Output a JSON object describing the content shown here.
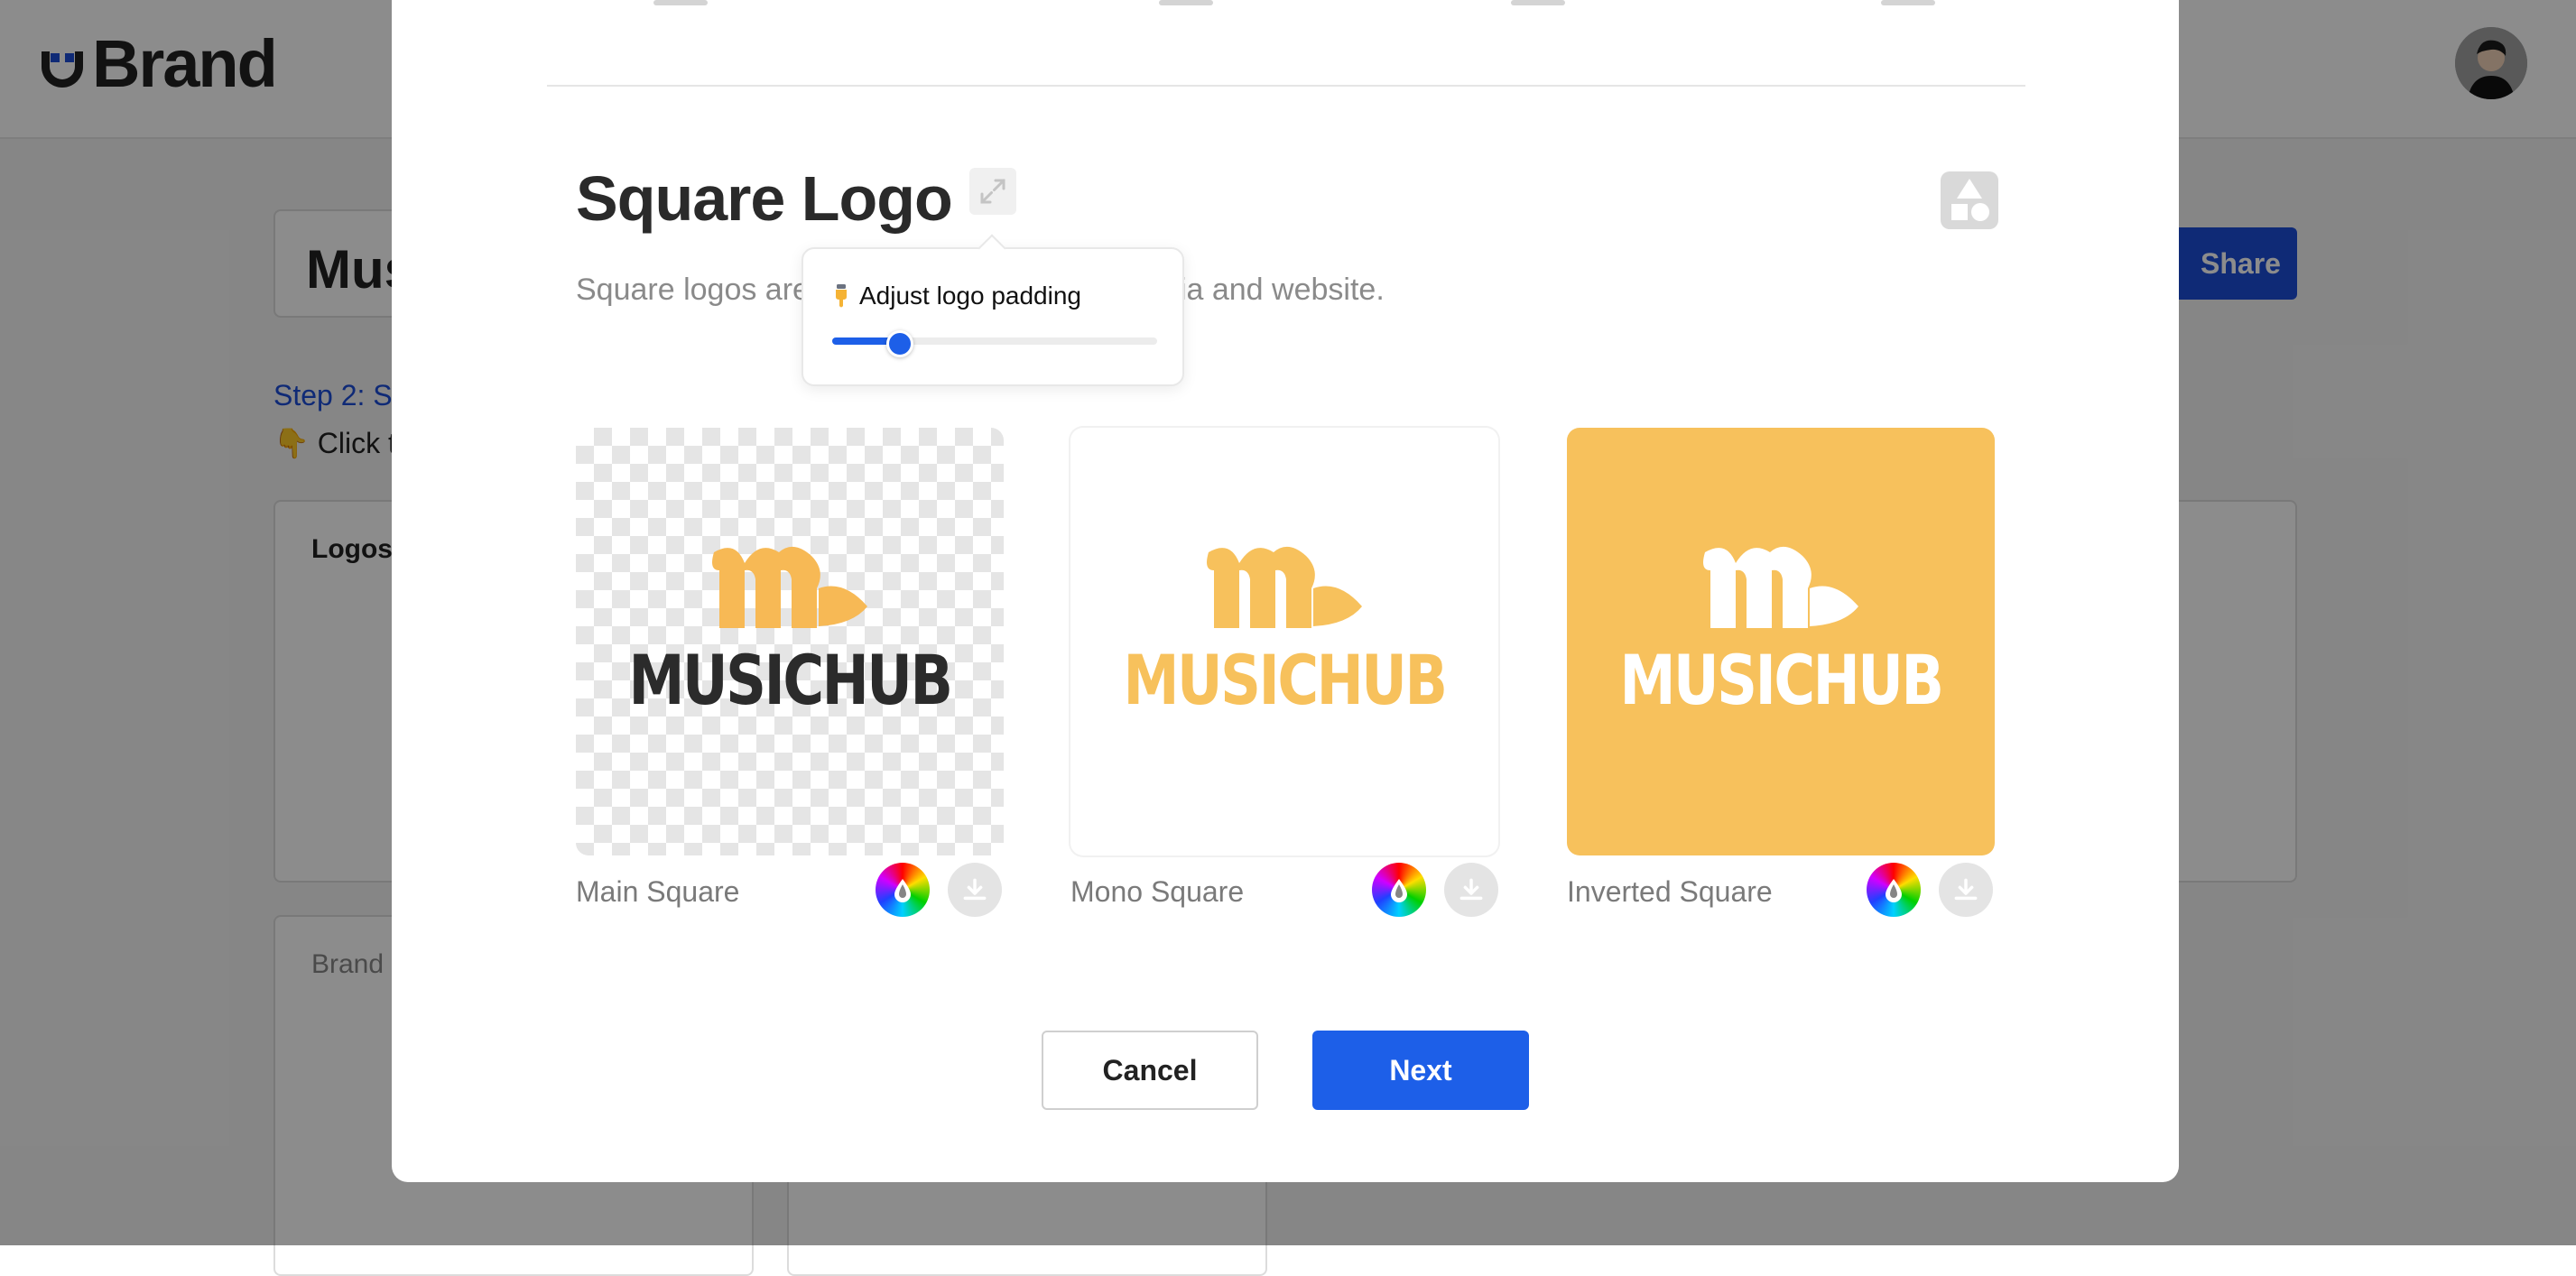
{
  "app": {
    "brand": "Brand",
    "brand_accent": "#1d4ed8"
  },
  "background": {
    "name_field": "Mus",
    "step_label": "Step 2: S",
    "click_hint": "Click t",
    "logos_card_title": "Logos",
    "brand_card_title": "Brand",
    "share_label": "Share"
  },
  "modal": {
    "section_title": "Square Logo",
    "section_subtitle_start": "Square logos are",
    "section_subtitle_end": "ia and website.",
    "icons": {
      "expand": "expand-icon",
      "shapes": "shapes-icon"
    },
    "popover": {
      "label": "Adjust logo padding",
      "slider_value": 0.2,
      "slider_color": "#1d5fe8"
    },
    "cards": [
      {
        "label": "Main Square",
        "style": "transparent",
        "wordmark": "MUSICHUB",
        "mark_color": "#f7b955",
        "word_color": "#2b2b2b"
      },
      {
        "label": "Mono Square",
        "style": "white",
        "wordmark": "MUSICHUB",
        "mark_color": "#f7c15c",
        "word_color": "#f7c15c"
      },
      {
        "label": "Inverted Square",
        "style": "inverted",
        "wordmark": "MUSICHUB",
        "mark_color": "#ffffff",
        "word_color": "#ffffff",
        "background": "#f7c15c"
      }
    ],
    "buttons": {
      "cancel": "Cancel",
      "next": "Next"
    }
  }
}
